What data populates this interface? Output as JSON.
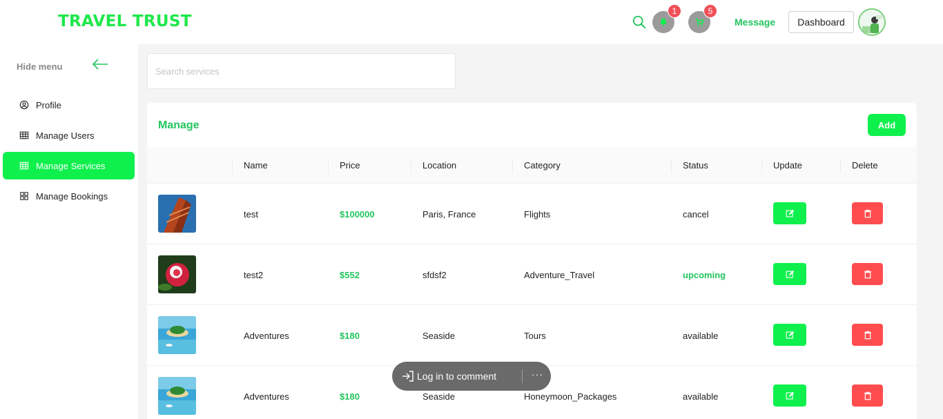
{
  "header": {
    "logo": "TRAVEL TRUST",
    "notifications_count": "1",
    "cart_count": "5",
    "message_label": "Message",
    "dashboard_label": "Dashboard"
  },
  "sidebar": {
    "hide_menu_label": "Hide menu",
    "items": [
      {
        "label": "Profile",
        "icon": "user-circle-icon"
      },
      {
        "label": "Manage Users",
        "icon": "table-icon"
      },
      {
        "label": "Manage Services",
        "icon": "table-icon",
        "active": true
      },
      {
        "label": "Manage Bookings",
        "icon": "grid-icon"
      }
    ]
  },
  "search": {
    "placeholder": "Search services",
    "value": ""
  },
  "manage": {
    "title": "Manage",
    "add_label": "Add",
    "columns": [
      "Name",
      "Price",
      "Location",
      "Category",
      "Status",
      "Update",
      "Delete"
    ],
    "rows": [
      {
        "name": "test",
        "price": "$100000",
        "location": "Paris, France",
        "category": "Flights",
        "status": "cancel"
      },
      {
        "name": "test2",
        "price": "$552",
        "location": "sfdsf2",
        "category": "Adventure_Travel",
        "status": "upcoming"
      },
      {
        "name": "Adventures",
        "price": "$180",
        "location": "Seaside",
        "category": "Tours",
        "status": "available"
      },
      {
        "name": "Adventures",
        "price": "$180",
        "location": "Seaside",
        "category": "Honeymoon_Packages",
        "status": "available"
      }
    ]
  },
  "login_pill": {
    "label": "Log in to comment",
    "more": "···"
  },
  "colors": {
    "accent": "#0ff04d",
    "accent_text": "#22c55e",
    "danger": "#ff4d4f",
    "badge": "#f0505a"
  }
}
